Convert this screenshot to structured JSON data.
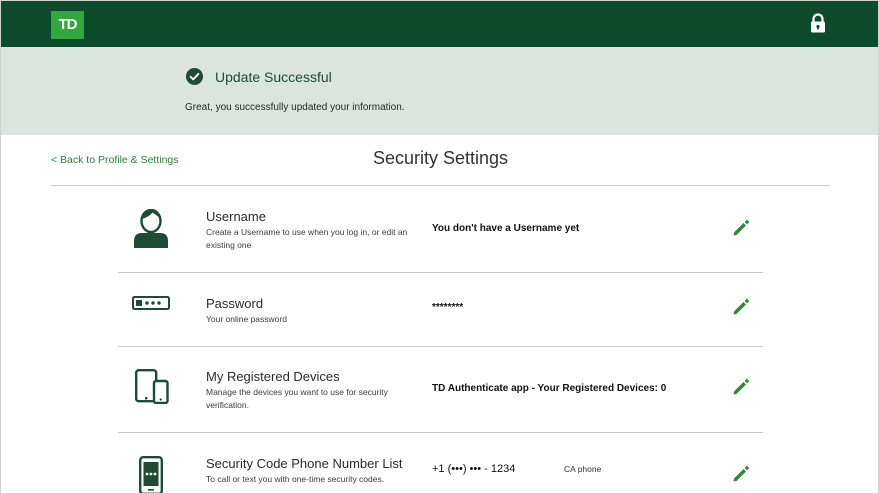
{
  "header": {
    "logo_text": "TD",
    "lock_icon": "lock-icon",
    "bg_color": "#0e4a2c",
    "logo_color": "#34a83e"
  },
  "banner": {
    "title": "Update Successful",
    "message": "Great, you successfully updated your information.",
    "icon": "check-circle-icon",
    "bg_color": "#dbe5de"
  },
  "nav": {
    "back_link": "< Back to Profile & Settings"
  },
  "page": {
    "title": "Security Settings"
  },
  "rows": [
    {
      "icon": "user-icon",
      "title": "Username",
      "description": "Create a Username to use when you log in, or edit an existing one",
      "value": "You don't have a Username yet",
      "action_icon": "pencil-icon"
    },
    {
      "icon": "password-icon",
      "title": "Password",
      "description": "Your online password",
      "value": "********",
      "action_icon": "pencil-icon"
    },
    {
      "icon": "devices-icon",
      "title": "My Registered Devices",
      "description": "Manage the devices you want to use for security verification.",
      "value": "TD Authenticate app - Your Registered Devices: 0",
      "action_icon": "pencil-icon"
    },
    {
      "icon": "phone-icon",
      "title": "Security Code Phone Number List",
      "description": "To call or text you with one-time security codes.",
      "value": "+1 (•••) ••• - 1234",
      "extra": "CA phone",
      "action_icon": "pencil-icon"
    }
  ],
  "colors": {
    "accent": "#2f7d3b",
    "icon_dark": "#1f4a33"
  }
}
